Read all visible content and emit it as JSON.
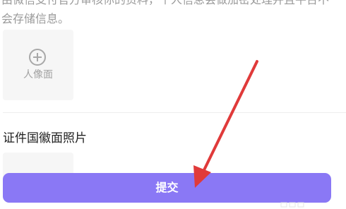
{
  "info": {
    "text": "由微信支付官方审核你的资料，个人信息会做加密处理并且平台不会存储信息。"
  },
  "portrait_upload": {
    "label": "人像面",
    "icon": "plus-circle-icon"
  },
  "emblem_section": {
    "title": "证件国徽面照片"
  },
  "submit": {
    "label": "提交"
  },
  "colors": {
    "accent": "#8a78f5",
    "annotation_arrow": "#e03a3a"
  }
}
